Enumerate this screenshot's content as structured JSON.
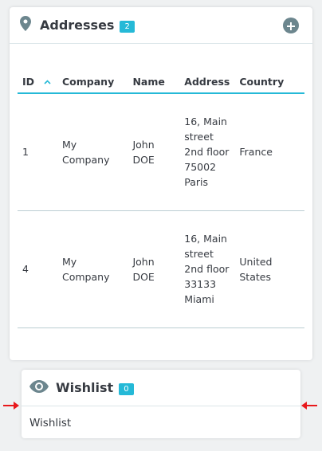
{
  "addresses": {
    "title": "Addresses",
    "count": "2",
    "icons": {
      "header": "map-marker-icon",
      "add": "add-circle-icon",
      "sort": "sort-ascending-icon"
    },
    "columns": [
      "ID",
      "Company",
      "Name",
      "Address",
      "Country"
    ],
    "rows": [
      {
        "id": "1",
        "company": "My Company",
        "name": "John DOE",
        "address": "16, Main street 2nd floor 75002 Paris",
        "country": "France"
      },
      {
        "id": "4",
        "company": "My Company",
        "name": "John DOE",
        "address": "16, Main street 2nd floor 33133 Miami",
        "country": "United States"
      }
    ]
  },
  "wishlist": {
    "title": "Wishlist",
    "count": "0",
    "icon": "eye-icon",
    "content": "Wishlist"
  },
  "colors": {
    "accent": "#25b9d7",
    "icon": "#6c868e",
    "arrow": "#e8181b"
  }
}
